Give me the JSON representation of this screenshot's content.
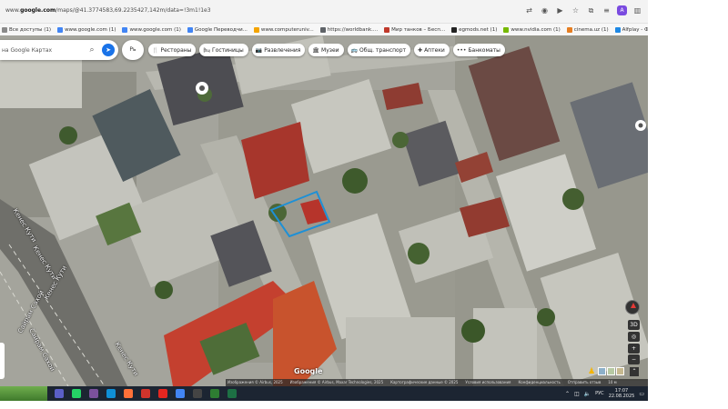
{
  "browser": {
    "url_prefix": "www.",
    "url_domain": "google.com",
    "url_rest": "/maps/@41.3774583,69.2235427,142m/data=!3m1!1e3",
    "icons": [
      "translate-icon",
      "camera-icon",
      "play-icon",
      "bookmark-star-icon",
      "extensions-icon",
      "menu-icon",
      "sidebar-icon"
    ],
    "profile_letter": "A"
  },
  "bookmarks": [
    {
      "label": "Все доступы (1)",
      "color": "#8a8a8a"
    },
    {
      "label": "www.google.com (1)",
      "color": "#4285f4"
    },
    {
      "label": "www.google.com (1)",
      "color": "#4285f4"
    },
    {
      "label": "Google Переводчи...",
      "color": "#4285f4"
    },
    {
      "label": "www.computeruniv...",
      "color": "#f4a400"
    },
    {
      "label": "https://worldbank....",
      "color": "#5f6368"
    },
    {
      "label": "Мир танков – Бесп...",
      "color": "#c0392b"
    },
    {
      "label": "egmods.net (1)",
      "color": "#222222"
    },
    {
      "label": "www.nvidia.com (1)",
      "color": "#76b900"
    },
    {
      "label": "cinema.uz (1)",
      "color": "#e67e22"
    },
    {
      "label": "Alfplay - Фильмы, с...",
      "color": "#1e88e5"
    },
    {
      "label": "Подписки | ITVuz -...",
      "color": "#222222"
    }
  ],
  "map": {
    "search_placeholder": "на Google Картах",
    "layers_label": "Рь",
    "chips": [
      {
        "label": "Рестораны",
        "icon": "🍴"
      },
      {
        "label": "Гостиницы",
        "icon": "🛏"
      },
      {
        "label": "Развлечения",
        "icon": "📷"
      },
      {
        "label": "Музеи",
        "icon": "🏛"
      },
      {
        "label": "Общ. транспорт",
        "icon": "🚌"
      },
      {
        "label": "Аптеки",
        "icon": "✚"
      },
      {
        "label": "Банкоматы",
        "icon": "•••"
      }
    ],
    "road_label_1": "Кенес Кути",
    "road_label_2": "Кенес Кути",
    "road_label_3": "Кенес Кути",
    "road_label_4": "Кенес Кути",
    "road_label_5": "Сайрам Сахой",
    "road_label_6": "Сайрам Сахой",
    "controls": {
      "tilt": "3D",
      "zoom_in": "+",
      "zoom_out": "−",
      "locate": "◎"
    },
    "google_logo": "Google",
    "attribution": [
      "Изображения © Airbus, 2025",
      "Изображения © Airbus, Maxar Technologies, 2025",
      "Картографические данные © 2025",
      "Условия использования",
      "Конфиденциальность",
      "Отправить отзыв",
      "10 м"
    ]
  },
  "taskbar": {
    "apps": [
      {
        "name": "teams",
        "color": "#5b5fc7"
      },
      {
        "name": "whatsapp",
        "color": "#25d366"
      },
      {
        "name": "viber",
        "color": "#7b519d"
      },
      {
        "name": "edge",
        "color": "#0f8fd6"
      },
      {
        "name": "firefox",
        "color": "#ff7139"
      },
      {
        "name": "app-red",
        "color": "#d0342c"
      },
      {
        "name": "yandex",
        "color": "#e52620"
      },
      {
        "name": "chrome",
        "color": "#4285f4"
      },
      {
        "name": "terminal",
        "color": "#444444"
      },
      {
        "name": "app-green",
        "color": "#2e7d32"
      },
      {
        "name": "excel",
        "color": "#1d7044"
      }
    ],
    "language": "РУС",
    "time": "17:07",
    "date": "22.08.2025"
  }
}
